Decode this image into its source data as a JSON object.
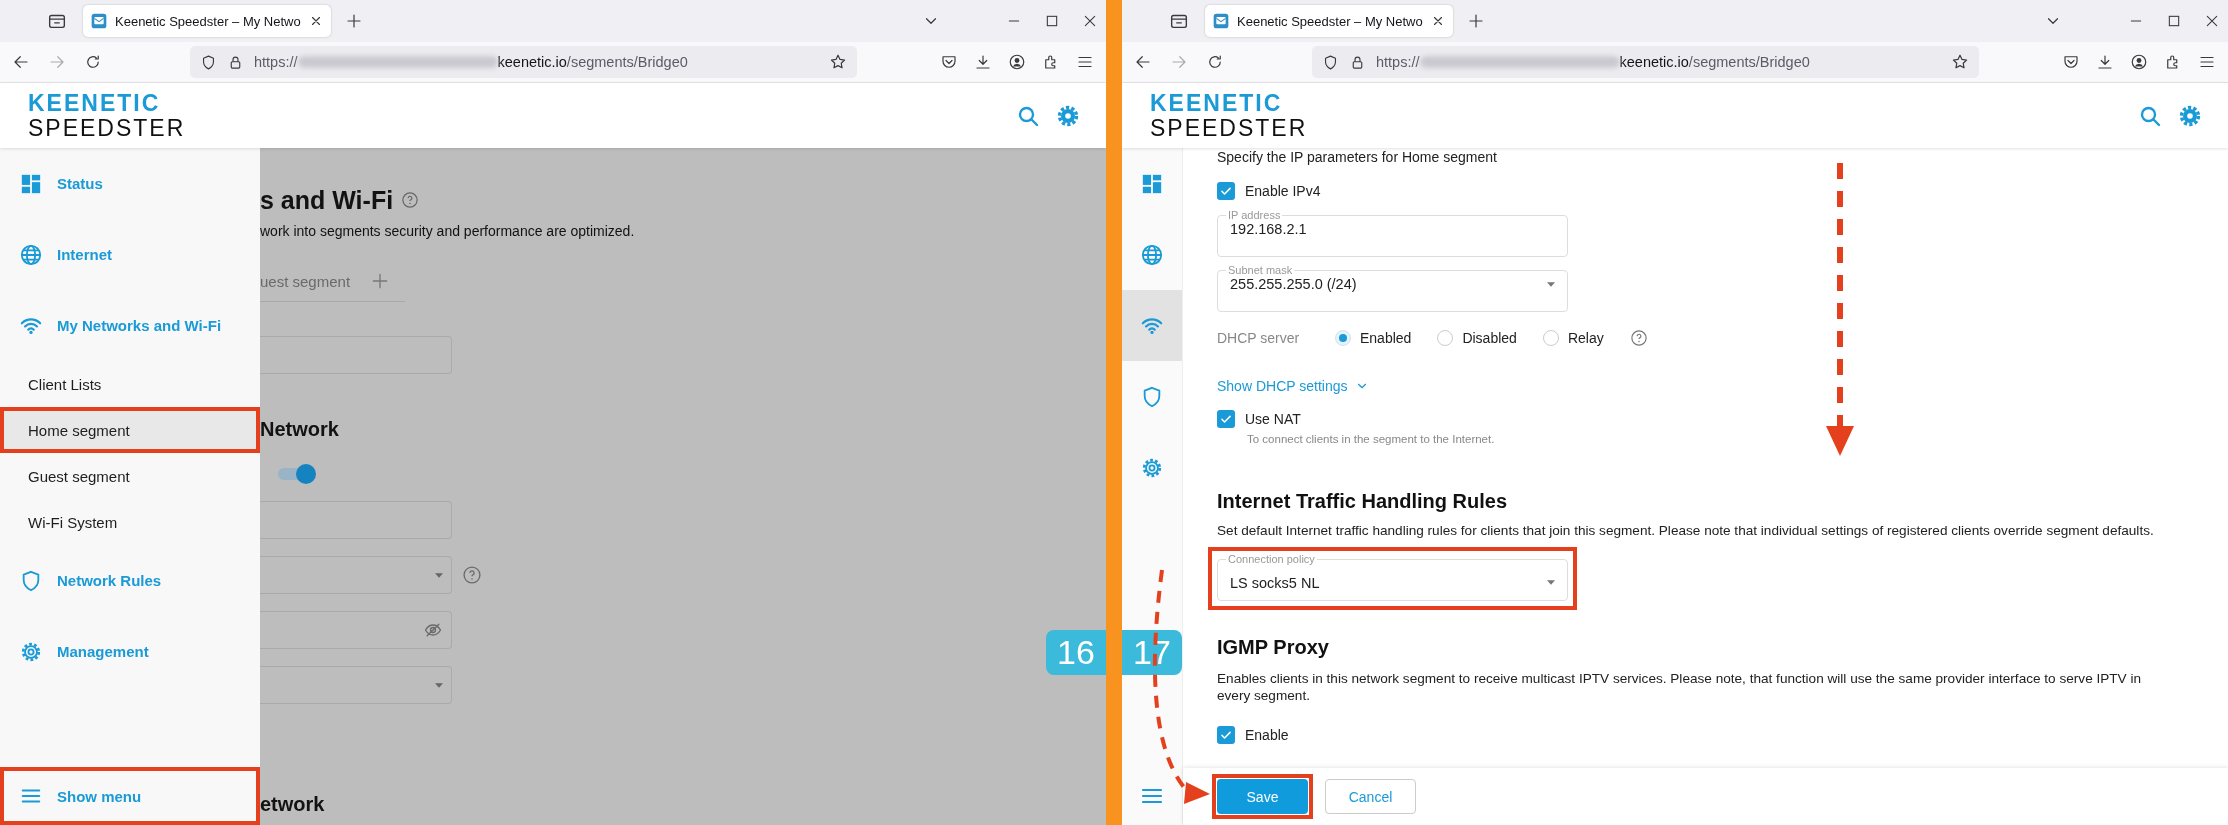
{
  "left_window": {
    "browser": {
      "tab": {
        "title": "Keenetic Speedster – My Netwo",
        "selected": true
      },
      "url": {
        "scheme": "https://",
        "domain": "keenetic.io",
        "path": "/segments/Bridge0"
      },
      "logo": {
        "line_1": "KEENETIC",
        "line_2": "SPEEDSTER"
      }
    },
    "menu": {
      "items": [
        {
          "kind": "section",
          "label": "Status",
          "selected": false,
          "highlighted": false
        },
        {
          "kind": "section",
          "label": "Internet",
          "selected": false,
          "highlighted": false
        },
        {
          "kind": "section",
          "label": "My Networks and Wi-Fi",
          "selected": false,
          "highlighted": false
        },
        {
          "kind": "link",
          "label": "Client Lists",
          "selected": false,
          "highlighted": false
        },
        {
          "kind": "link",
          "label": "Home segment",
          "selected": true,
          "highlighted": true
        },
        {
          "kind": "link",
          "label": "Guest segment",
          "selected": false,
          "highlighted": false
        },
        {
          "kind": "link",
          "label": "Wi-Fi System",
          "selected": false,
          "highlighted": false
        },
        {
          "kind": "section",
          "label": "Network Rules",
          "selected": false,
          "highlighted": false
        },
        {
          "kind": "section",
          "label": "Management",
          "selected": false,
          "highlighted": false
        }
      ],
      "show_menu": {
        "label": "Show menu",
        "highlighted": true
      }
    },
    "background_page": {
      "title": "s and Wi-Fi",
      "description": "work into segments security and performance are optimized.",
      "segment_tab": "uest segment",
      "first_field": {
        "kind": "text"
      },
      "section_title": "Network",
      "toggle": {
        "on": true
      },
      "fields": [
        {
          "kind": "text"
        },
        {
          "kind": "select_with_help"
        },
        {
          "kind": "password"
        },
        {
          "kind": "select"
        }
      ],
      "next_section_title": "etwork"
    }
  },
  "right_window": {
    "browser": {
      "tab": {
        "title": "Keenetic Speedster – My Netwo",
        "selected": true
      },
      "url": {
        "scheme": "https://",
        "domain": "keenetic.io",
        "path": "/segments/Bridge0"
      },
      "logo": {
        "line_1": "KEENETIC",
        "line_2": "SPEEDSTER"
      }
    },
    "rail": {
      "items": [
        {
          "selected": false
        },
        {
          "selected": false
        },
        {
          "selected": true
        },
        {
          "selected": false
        },
        {
          "selected": false
        }
      ]
    },
    "ip_settings": {
      "intro": "Specify the IP parameters for Home segment",
      "enable_ipv4": {
        "label": "Enable IPv4",
        "checked": true
      },
      "ip_address": {
        "label": "IP address",
        "value": "192.168.2.1"
      },
      "subnet_mask": {
        "label": "Subnet mask",
        "value": "255.255.255.0 (/24)"
      },
      "dhcp_server": {
        "label": "DHCP server",
        "options": [
          {
            "label": "Enabled",
            "selected": true
          },
          {
            "label": "Disabled",
            "selected": false
          },
          {
            "label": "Relay",
            "selected": false
          }
        ]
      },
      "dhcp_settings_link": "Show DHCP settings",
      "use_nat": {
        "label": "Use NAT",
        "checked": true,
        "hint": "To connect clients in the segment to the Internet."
      }
    },
    "traffic_rules": {
      "title": "Internet Traffic Handling Rules",
      "description": "Set default Internet traffic handling rules for clients that join this segment. Please note that individual settings of registered clients override segment defaults.",
      "connection_policy": {
        "label": "Connection policy",
        "value": "LS socks5 NL",
        "highlighted": true
      }
    },
    "igmp_proxy": {
      "title": "IGMP Proxy",
      "description": "Enables clients in this network segment to receive multicast IPTV services. Please note, that function will use the same provider interface to serve IPTV in every segment.",
      "enable": {
        "label": "Enable",
        "checked": true
      }
    },
    "footer": {
      "buttons": [
        {
          "kind": "primary",
          "label": "Save",
          "highlighted": true
        },
        {
          "kind": "secondary",
          "label": "Cancel",
          "highlighted": false
        }
      ]
    }
  },
  "step_badges": [
    {
      "label": "16"
    },
    {
      "label": "17"
    }
  ]
}
